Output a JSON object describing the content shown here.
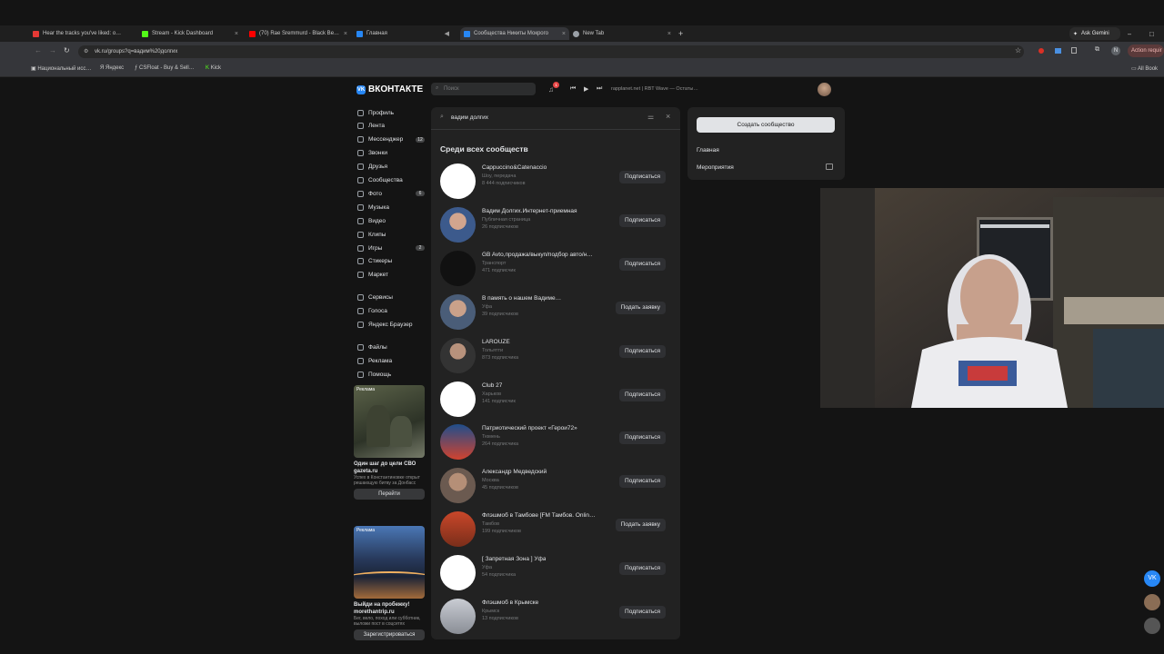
{
  "browser": {
    "tabs": [
      {
        "title": "Hear the tracks you've liked: o…",
        "color": "#e53935"
      },
      {
        "title": "Stream - Kick Dashboard",
        "color": "#53fc18"
      },
      {
        "title": "(70) Rae Sremmurd - Black Be…",
        "color": "#ff0000"
      },
      {
        "title": "Главная",
        "color": "#2787f5"
      },
      {
        "title": "Сообщества Никиты Мокрого",
        "color": "#2787f5"
      },
      {
        "title": "New Tab",
        "color": "#9aa0a6"
      }
    ],
    "ask_gemini": "Ask Gemini",
    "url": "vk.ru/groups?q=вадим%20долгих",
    "action_label": "Action requir",
    "bookmarks": [
      "Национальный исс…",
      "Яндекс",
      "CSFloat - Buy & Sell…",
      "Kick"
    ],
    "all_bookmarks": "All Book"
  },
  "vk": {
    "logo": "ВКОНТАКТЕ",
    "logo_mark": "VK",
    "search_placeholder": "Поиск",
    "notif_count": "1",
    "player_text": "rapplanet.net | RBT Wave — Остаты…",
    "nav": [
      {
        "label": "Профиль",
        "count": ""
      },
      {
        "label": "Лента",
        "count": ""
      },
      {
        "label": "Мессенджер",
        "count": "12"
      },
      {
        "label": "Звонки",
        "count": ""
      },
      {
        "label": "Друзья",
        "count": ""
      },
      {
        "label": "Сообщества",
        "count": ""
      },
      {
        "label": "Фото",
        "count": "6"
      },
      {
        "label": "Музыка",
        "count": ""
      },
      {
        "label": "Видео",
        "count": ""
      },
      {
        "label": "Клипы",
        "count": ""
      },
      {
        "label": "Игры",
        "count": "2"
      },
      {
        "label": "Стикеры",
        "count": ""
      },
      {
        "label": "Маркет",
        "count": ""
      }
    ],
    "nav2": [
      "Сервисы",
      "Голоса",
      "Яндекс Браузер"
    ],
    "nav3": [
      "Файлы",
      "Реклама",
      "Помощь"
    ],
    "ads": [
      {
        "tag": "Реклама",
        "title": "Один шаг до цели СВО gazeta.ru",
        "desc": "Успех в Константиновке открыт решающую битву за Донбасс",
        "button": "Перейти"
      },
      {
        "tag": "Реклама",
        "title": "Выйди на пробежку! morethantrip.ru",
        "desc": "Бег, вело, поход или субботник, выложи пост в соцсетях",
        "button": "Зарегистрироваться"
      }
    ],
    "search_value": "вадим долгих",
    "section_title": "Среди всех сообществ",
    "results": [
      {
        "name": "Cappuccino&Catenaccio",
        "sub": "Шоу, передача",
        "count": "8 444 подписчиков",
        "button": "Подписаться"
      },
      {
        "name": "Вадим Долгих.Интернет-приемная",
        "sub": "Публичная страница",
        "count": "26 подписчиков",
        "button": "Подписаться"
      },
      {
        "name": "GB Avto,продажа/выкуп/подбор авто/н…",
        "sub": "Транспорт",
        "count": "471 подписчик",
        "button": "Подписаться"
      },
      {
        "name": "В память о нашем Вадиме…",
        "sub": "Уфа",
        "count": "39 подписчиков",
        "button": "Подать заявку"
      },
      {
        "name": "LAROUZE",
        "sub": "Тольятти",
        "count": "873 подписчика",
        "button": "Подписаться"
      },
      {
        "name": "Club 27",
        "sub": "Харьков",
        "count": "141 подписчик",
        "button": "Подписаться"
      },
      {
        "name": "Патриотический проект «Герои72»",
        "sub": "Тюмень",
        "count": "264 подписчика",
        "button": "Подписаться"
      },
      {
        "name": "Александр Медведский",
        "sub": "Москва",
        "count": "45 подписчиков",
        "button": "Подписаться"
      },
      {
        "name": "Флэшмоб в Тамбове [FM Тамбов. Onlin…",
        "sub": "Тамбов",
        "count": "199 подписчиков",
        "button": "Подать заявку"
      },
      {
        "name": "[ Запретная Зона ] Уфа",
        "sub": "Уфа",
        "count": "54 подписчика",
        "button": "Подписаться"
      },
      {
        "name": "Флэшмоб в Крымске",
        "sub": "Крымск",
        "count": "13 подписчиков",
        "button": "Подписаться"
      }
    ],
    "right": {
      "create": "Создать сообщество",
      "links": [
        "Главная",
        "Мероприятия"
      ]
    }
  }
}
